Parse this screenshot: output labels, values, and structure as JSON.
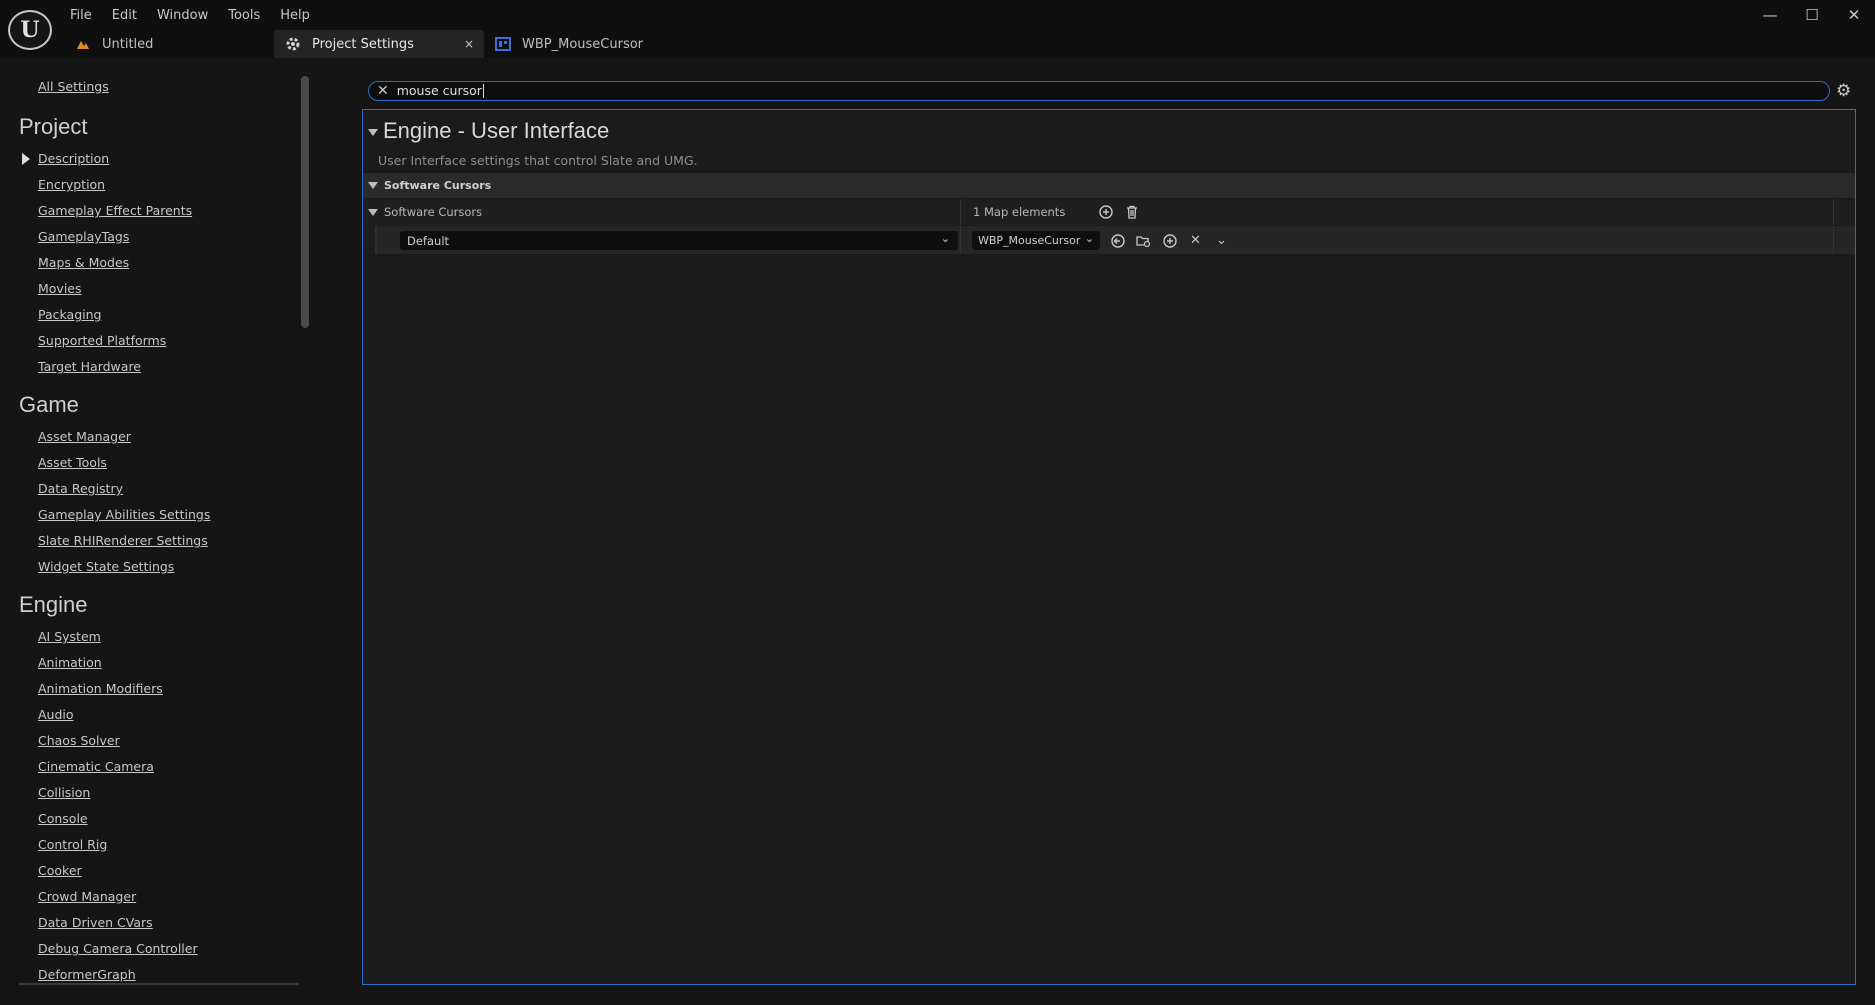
{
  "menu": [
    "File",
    "Edit",
    "Window",
    "Tools",
    "Help"
  ],
  "tabs": [
    {
      "label": "Untitled",
      "icon": "level-icon"
    },
    {
      "label": "Project Settings",
      "icon": "settings-icon",
      "close": "×"
    },
    {
      "label": "WBP_MouseCursor",
      "icon": "widget-blueprint-icon"
    }
  ],
  "search": {
    "value": "mouse cursor"
  },
  "sidebar": {
    "all_settings": "All Settings",
    "sections": [
      {
        "title": "Project",
        "items": [
          "Description",
          "Encryption",
          "Gameplay Effect Parents",
          "GameplayTags",
          "Maps & Modes",
          "Movies",
          "Packaging",
          "Supported Platforms",
          "Target Hardware"
        ]
      },
      {
        "title": "Game",
        "items": [
          "Asset Manager",
          "Asset Tools",
          "Data Registry",
          "Gameplay Abilities Settings",
          "Slate RHIRenderer Settings",
          "Widget State Settings"
        ]
      },
      {
        "title": "Engine",
        "items": [
          "AI System",
          "Animation",
          "Animation Modifiers",
          "Audio",
          "Chaos Solver",
          "Cinematic Camera",
          "Collision",
          "Console",
          "Control Rig",
          "Cooker",
          "Crowd Manager",
          "Data Driven CVars",
          "Debug Camera Controller",
          "DeformerGraph"
        ]
      }
    ]
  },
  "content": {
    "section_title": "Engine - User Interface",
    "section_desc": "User Interface settings that control Slate and UMG.",
    "category": "Software Cursors",
    "property": {
      "label": "Software Cursors",
      "count": "1 Map elements",
      "key": "Default",
      "value": "WBP_MouseCursor"
    }
  },
  "colors": {
    "accent": "#2a6fc4",
    "background": "#151515"
  }
}
